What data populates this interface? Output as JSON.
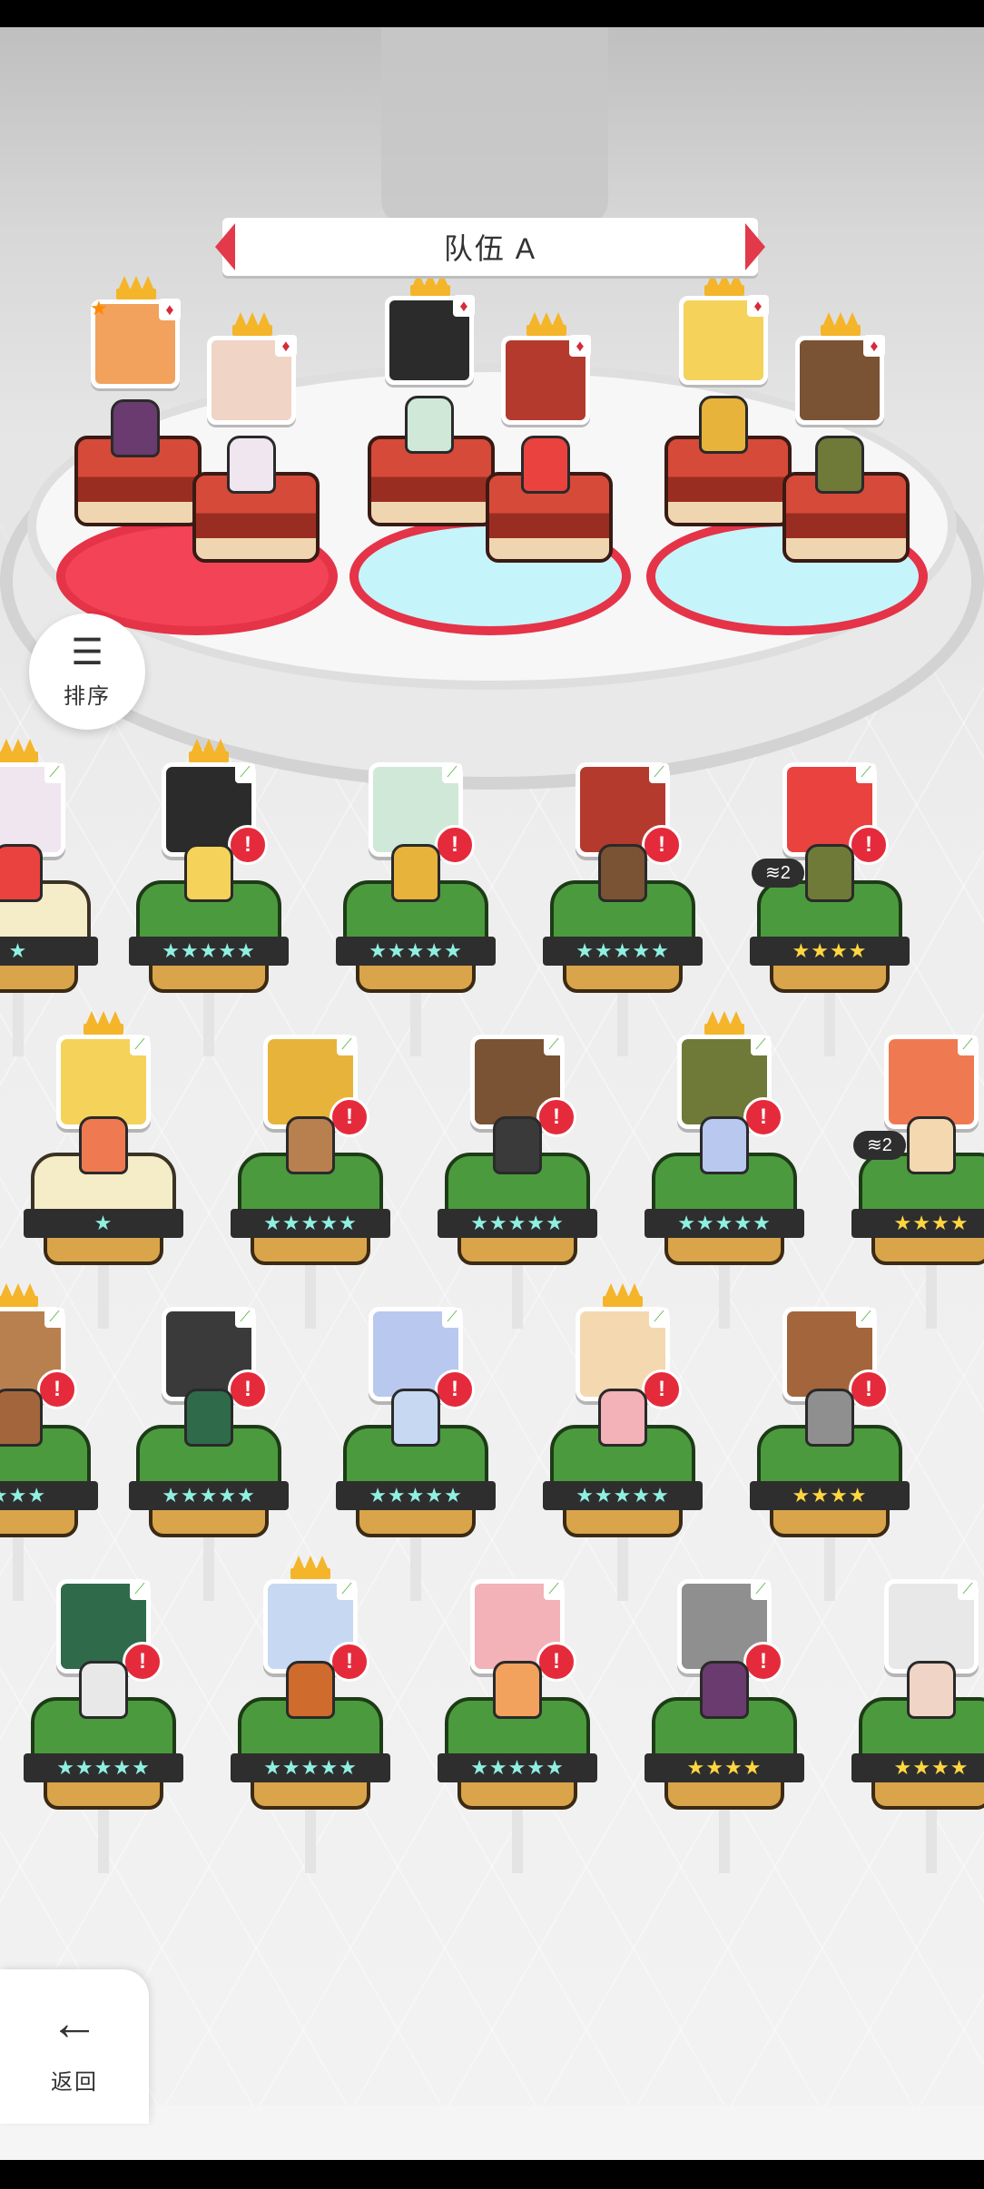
{
  "team": {
    "title": "队伍 A"
  },
  "sort_button": {
    "label": "排序",
    "icon": "sort-icon"
  },
  "back_button": {
    "label": "返回",
    "icon": "back-arrow-icon"
  },
  "team_members": [
    {
      "crown": true,
      "star": true,
      "suit": "♦"
    },
    {
      "crown": true,
      "star": false,
      "suit": "♦"
    },
    {
      "crown": true,
      "star": false,
      "suit": "♦"
    },
    {
      "crown": true,
      "star": false,
      "suit": "♦"
    },
    {
      "crown": true,
      "star": false,
      "suit": "♦"
    },
    {
      "crown": true,
      "star": false,
      "suit": "♦"
    }
  ],
  "roster_rows": [
    [
      {
        "stars": "★",
        "star_color": "cyan",
        "pedestal": "gold",
        "alert": false,
        "crown": true
      },
      {
        "stars": "★★★★★",
        "star_color": "cyan",
        "pedestal": "green",
        "alert": true,
        "crown": true
      },
      {
        "stars": "★★★★★",
        "star_color": "cyan",
        "pedestal": "green",
        "alert": true,
        "crown": false
      },
      {
        "stars": "★★★★★",
        "star_color": "cyan",
        "pedestal": "green",
        "alert": true,
        "crown": false
      },
      {
        "stars": "★★★★",
        "star_color": "gold",
        "pedestal": "green",
        "alert": true,
        "crown": false,
        "layer": "2"
      }
    ],
    [
      {
        "stars": "★",
        "star_color": "cyan",
        "pedestal": "gold",
        "alert": false,
        "crown": true
      },
      {
        "stars": "★★★★★",
        "star_color": "cyan",
        "pedestal": "green",
        "alert": true,
        "crown": false
      },
      {
        "stars": "★★★★★",
        "star_color": "cyan",
        "pedestal": "green",
        "alert": true,
        "crown": false
      },
      {
        "stars": "★★★★★",
        "star_color": "cyan",
        "pedestal": "green",
        "alert": true,
        "crown": true
      },
      {
        "stars": "★★★★",
        "star_color": "gold",
        "pedestal": "green",
        "alert": false,
        "crown": false,
        "layer": "2"
      }
    ],
    [
      {
        "stars": "★★★",
        "star_color": "cyan",
        "pedestal": "green",
        "alert": true,
        "crown": true
      },
      {
        "stars": "★★★★★",
        "star_color": "cyan",
        "pedestal": "green",
        "alert": true,
        "crown": false
      },
      {
        "stars": "★★★★★",
        "star_color": "cyan",
        "pedestal": "green",
        "alert": true,
        "crown": false
      },
      {
        "stars": "★★★★★",
        "star_color": "cyan",
        "pedestal": "green",
        "alert": true,
        "crown": true
      },
      {
        "stars": "★★★★",
        "star_color": "gold",
        "pedestal": "green",
        "alert": true,
        "crown": false
      }
    ],
    [
      {
        "stars": "★★★★★",
        "star_color": "cyan",
        "pedestal": "green",
        "alert": true,
        "crown": false
      },
      {
        "stars": "★★★★★",
        "star_color": "cyan",
        "pedestal": "green",
        "alert": true,
        "crown": true
      },
      {
        "stars": "★★★★★",
        "star_color": "cyan",
        "pedestal": "green",
        "alert": true,
        "crown": false
      },
      {
        "stars": "★★★★",
        "star_color": "gold",
        "pedestal": "green",
        "alert": true,
        "crown": false
      },
      {
        "stars": "★★★★",
        "star_color": "gold",
        "pedestal": "green",
        "alert": false,
        "crown": false
      }
    ]
  ],
  "colors": {
    "accent_red": "#e23a4a",
    "alert_red": "#e52b3b",
    "grass_green": "#4c9a3e",
    "star_gold": "#ffd640",
    "star_cyan": "#8ff0e2"
  }
}
